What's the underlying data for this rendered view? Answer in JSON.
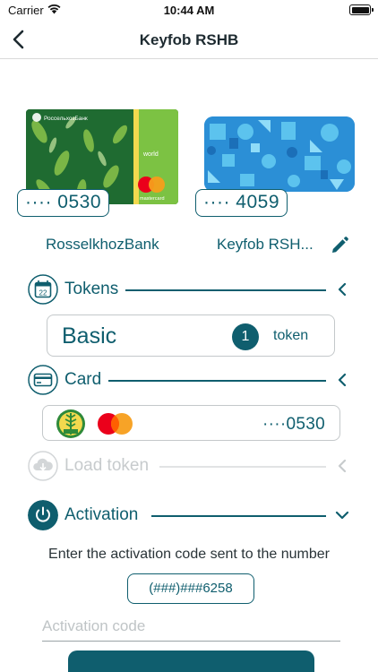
{
  "status_bar": {
    "carrier": "Carrier",
    "time": "10:44 AM"
  },
  "nav": {
    "title": "Keyfob RSHB",
    "back_icon": "chevron-left-icon"
  },
  "cards": [
    {
      "masked": "···· 0530",
      "name": "RosselkhozBank",
      "brand_text": "РоссельхозБанк",
      "tier_text": "world",
      "network_text": "mastercard"
    },
    {
      "masked": "···· 4059",
      "name": "Keyfob RSH..."
    }
  ],
  "sections": {
    "tokens": {
      "label": "Tokens",
      "calendar_day": "22",
      "option": "Basic",
      "count": "1",
      "unit": "token"
    },
    "card": {
      "label": "Card",
      "number": "····0530"
    },
    "load_token": {
      "label": "Load token"
    },
    "activation": {
      "label": "Activation",
      "info": "Enter the activation code sent to the number",
      "phone": "(###)###6258",
      "placeholder": "Activation code"
    }
  },
  "colors": {
    "accent": "#0f5e6e",
    "disabled": "#c7cbcd",
    "mc_red": "#eb001b",
    "mc_orange": "#f79e1b"
  }
}
